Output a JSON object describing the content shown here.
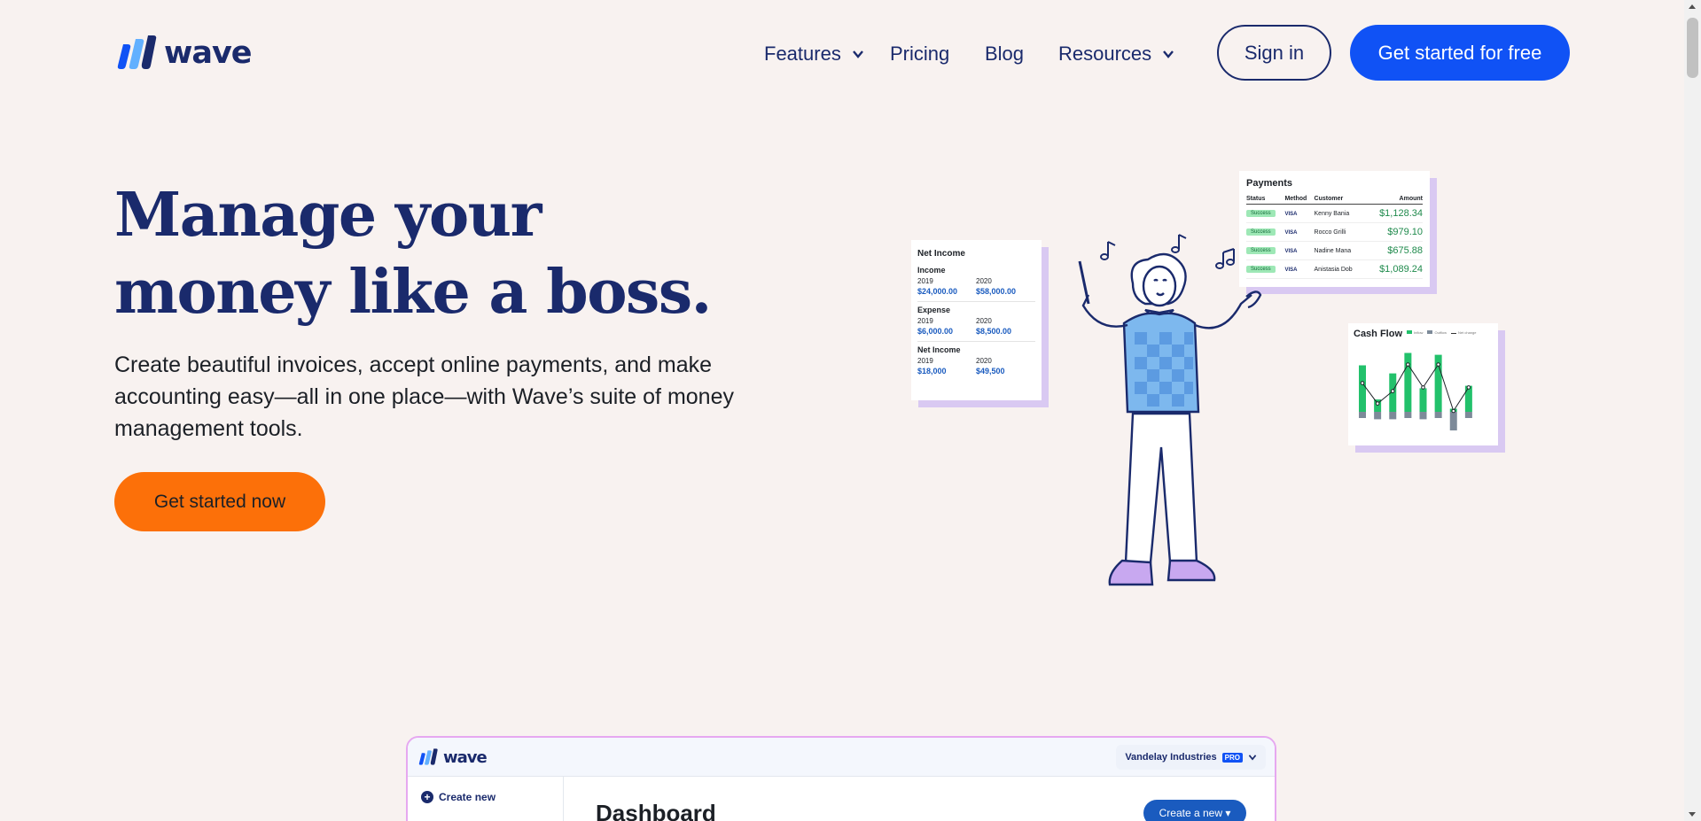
{
  "brand": {
    "name": "wave",
    "primary": "#1a2a6c",
    "accent": "#1052f5",
    "cta": "#fc7009"
  },
  "nav": {
    "items": [
      {
        "label": "Features",
        "has_dropdown": true
      },
      {
        "label": "Pricing",
        "has_dropdown": false
      },
      {
        "label": "Blog",
        "has_dropdown": false
      },
      {
        "label": "Resources",
        "has_dropdown": true
      }
    ],
    "sign_in": "Sign in",
    "get_started": "Get started for free"
  },
  "hero": {
    "title_line1": "Manage your",
    "title_line2": "money like a boss.",
    "subtitle": "Create beautiful invoices, accept online payments, and make accounting easy—all in one place—with Wave’s suite of money management tools.",
    "cta": "Get started now"
  },
  "net_income_card": {
    "title": "Net Income",
    "sections": [
      {
        "heading": "Income",
        "y1": "2019",
        "y2": "2020",
        "v1": "$24,000.00",
        "v2": "$58,000.00"
      },
      {
        "heading": "Expense",
        "y1": "2019",
        "y2": "2020",
        "v1": "$6,000.00",
        "v2": "$8,500.00"
      },
      {
        "heading": "Net Income",
        "y1": "2019",
        "y2": "2020",
        "v1": "$18,000",
        "v2": "$49,500"
      }
    ]
  },
  "payments_card": {
    "title": "Payments",
    "columns": [
      "Status",
      "Method",
      "Customer",
      "Amount"
    ],
    "rows": [
      {
        "status": "Success",
        "method": "VISA",
        "customer": "Kenny Bania",
        "amount": "$1,128.34"
      },
      {
        "status": "Success",
        "method": "VISA",
        "customer": "Rocco Grilli",
        "amount": "$979.10"
      },
      {
        "status": "Success",
        "method": "VISA",
        "customer": "Nadine Mana",
        "amount": "$675.88"
      },
      {
        "status": "Success",
        "method": "VISA",
        "customer": "Anistasia Dob",
        "amount": "$1,089.24"
      }
    ]
  },
  "cash_flow_card": {
    "title": "Cash Flow",
    "legend": [
      "Inflow",
      "Outflow",
      "Net change"
    ],
    "inflow": [
      0.75,
      0.2,
      0.62,
      0.95,
      0.38,
      0.92,
      0.05,
      0.42
    ],
    "outflow": [
      0.1,
      0.12,
      0.12,
      0.1,
      0.12,
      0.1,
      0.3,
      0.1
    ],
    "net": [
      0.55,
      0.22,
      0.42,
      0.85,
      0.48,
      0.85,
      0.1,
      0.48
    ]
  },
  "dashboard": {
    "logo": "wave",
    "business": "Vandelay Industries",
    "badge": "PRO",
    "create_new": "Create new",
    "heading": "Dashboard",
    "create_btn": "Create a new ▾"
  }
}
